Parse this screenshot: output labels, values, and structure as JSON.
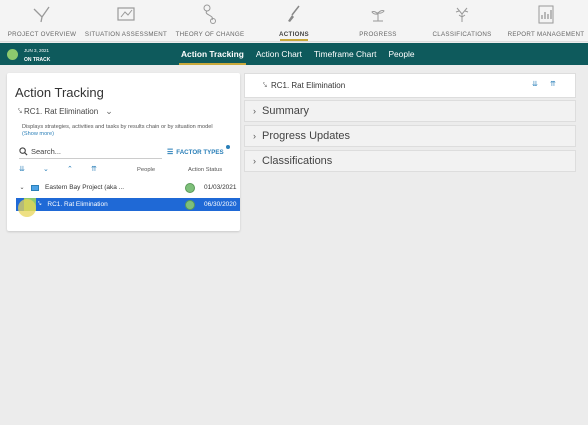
{
  "nav": {
    "items": [
      {
        "label": "PROJECT OVERVIEW",
        "icon": "bird-icon"
      },
      {
        "label": "SITUATION ASSESSMENT",
        "icon": "map-icon"
      },
      {
        "label": "THEORY OF CHANGE",
        "icon": "path-icon"
      },
      {
        "label": "ACTIONS",
        "icon": "shovel-icon",
        "active": true
      },
      {
        "label": "PROGRESS",
        "icon": "seedling-icon"
      },
      {
        "label": "CLASSIFICATIONS",
        "icon": "coral-icon"
      },
      {
        "label": "REPORT MANAGEMENT",
        "icon": "report-icon"
      }
    ]
  },
  "status": {
    "date": "JUN 3, 2021",
    "state": "ON TRACK",
    "color": "#8dc96e"
  },
  "subnav": {
    "tabs": [
      {
        "label": "Action Tracking",
        "active": true
      },
      {
        "label": "Action Chart"
      },
      {
        "label": "Timeframe Chart"
      },
      {
        "label": "People"
      }
    ]
  },
  "left": {
    "title": "Action Tracking",
    "strategy": "RC1. Rat Elimination",
    "description": "Displays strategies, activities and tasks by results chain or by situation model",
    "show_more": "(Show more)",
    "search_placeholder": "Search...",
    "factor_types": "FACTOR TYPES",
    "col_people": "People",
    "col_status": "Action Status",
    "rows": [
      {
        "name": "Eastern Bay Project (aka ...",
        "date": "01/03/2021"
      },
      {
        "name": "RC1. Rat Elimination",
        "date": "06/30/2020"
      }
    ]
  },
  "right": {
    "header": "RC1. Rat Elimination",
    "sections": [
      {
        "label": "Summary"
      },
      {
        "label": "Progress Updates"
      },
      {
        "label": "Classifications"
      }
    ]
  },
  "colors": {
    "accent": "#2a7fb8",
    "subnav": "#0e5a5c",
    "selected": "#1f69d6",
    "tab_underline": "#c9a93b"
  }
}
